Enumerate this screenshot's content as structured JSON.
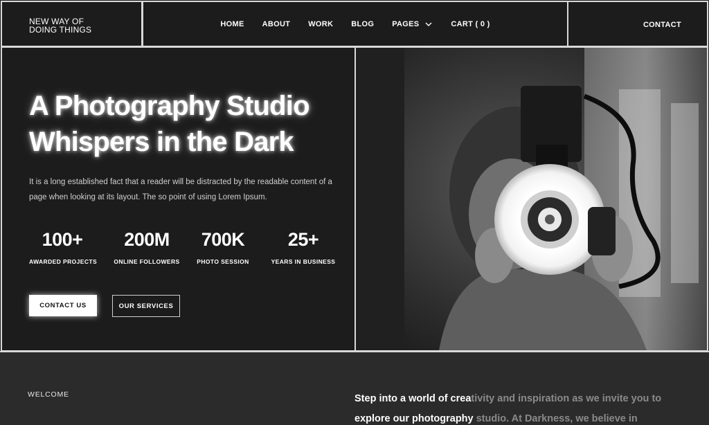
{
  "brand": {
    "line1": "NEW WAY OF",
    "line2": "DOING THINGS"
  },
  "nav": {
    "items": [
      "HOME",
      "ABOUT",
      "WORK",
      "BLOG",
      "PAGES",
      "CART ( 0 )"
    ],
    "contact": "CONTACT"
  },
  "hero": {
    "title_line1": "A Photography Studio",
    "title_line2": "Whispers in the Dark",
    "description": "It is a long established fact that a reader will be distracted by the readable content of a page when looking at its layout. The so point of using Lorem Ipsum.",
    "stats": [
      {
        "value": "100+",
        "label": "AWARDED PROJECTS"
      },
      {
        "value": "200M",
        "label": "ONLINE FOLLOWERS"
      },
      {
        "value": "700K",
        "label": "PHOTO SESSION"
      },
      {
        "value": "25+",
        "label": "YEARS IN BUSINESS"
      }
    ],
    "primary_button": "CONTACT US",
    "secondary_button": "OUR SERVICES"
  },
  "welcome": {
    "label": "WELCOME",
    "intro_bright_1": "Step into a world of crea",
    "intro_dim_1": "tivity and inspiration as we invite you to",
    "intro_bright_2": "explore our photography",
    "intro_dim_2": " studio. At Darkness, we believe in"
  },
  "colors": {
    "background": "#1c1c1c",
    "border": "#d9d9d9",
    "text": "#ffffff",
    "muted": "#8a8a8a"
  },
  "icons": {
    "pages_dropdown": "chevron-down-icon",
    "hero_image": "photographer-camera-image"
  }
}
